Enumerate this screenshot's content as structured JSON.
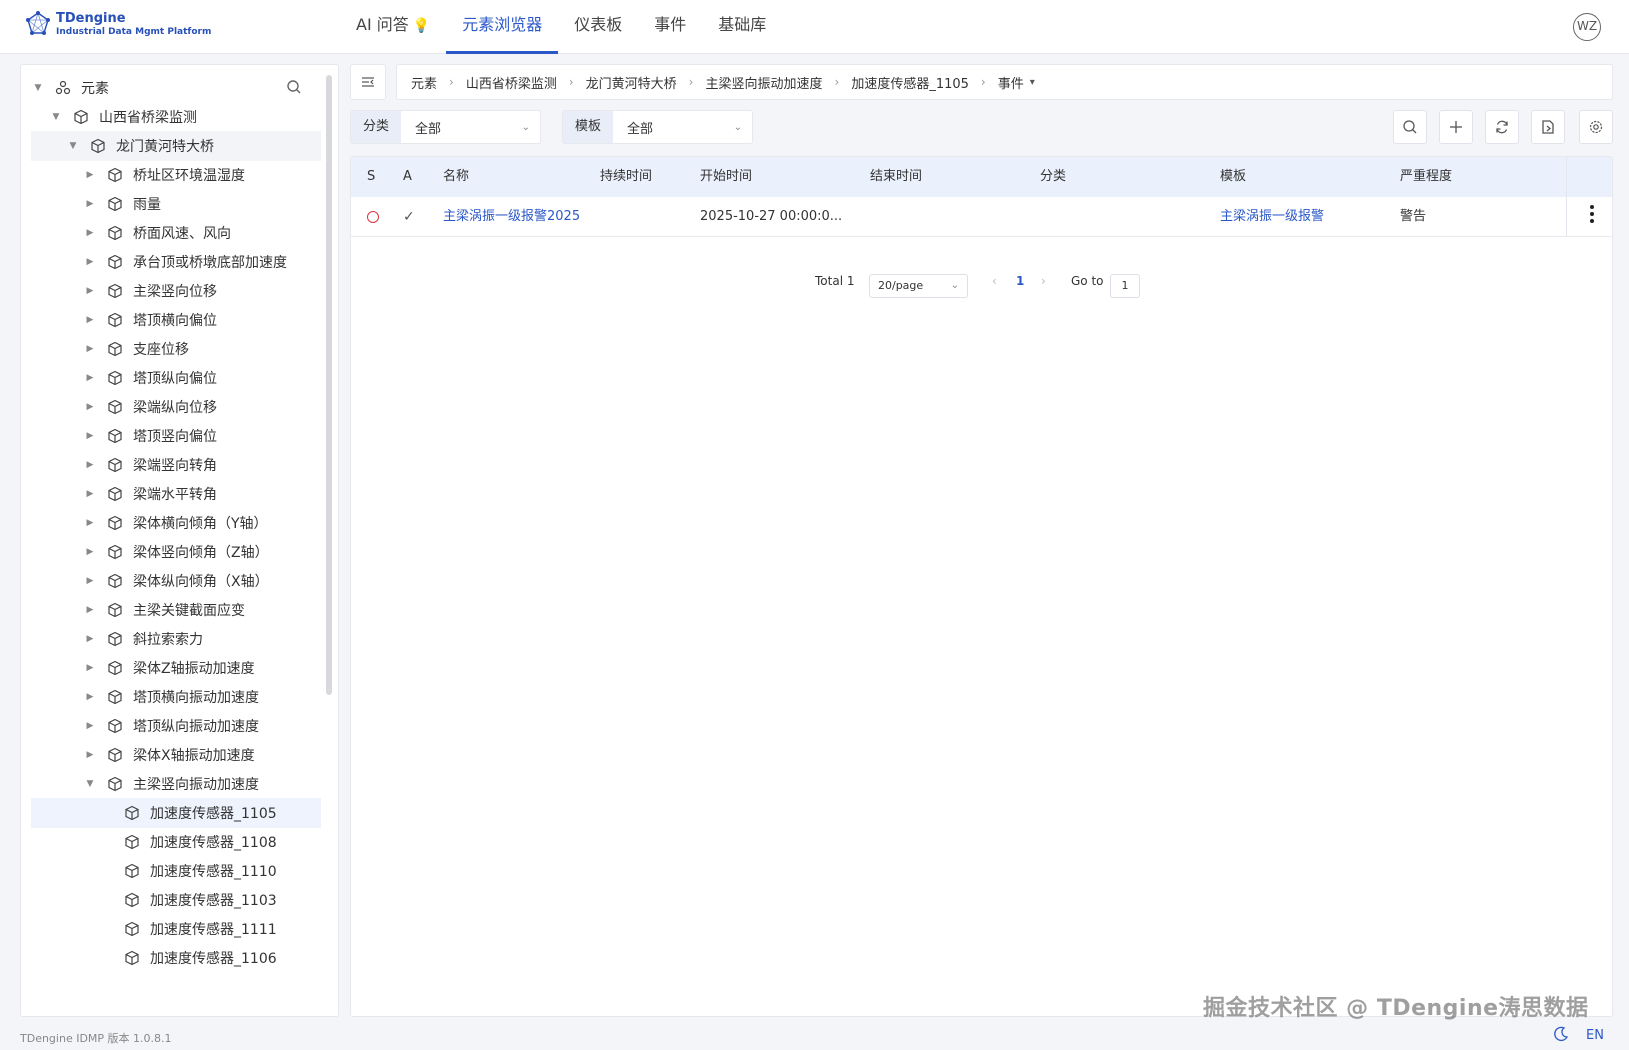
{
  "brand": {
    "name": "TDengine",
    "tagline": "Industrial Data Mgmt Platform"
  },
  "nav": [
    {
      "label": "AI 问答",
      "active": false
    },
    {
      "label": "元素浏览器",
      "active": true
    },
    {
      "label": "仪表板",
      "active": false
    },
    {
      "label": "事件",
      "active": false
    },
    {
      "label": "基础库",
      "active": false
    }
  ],
  "user": {
    "initials": "WZ"
  },
  "tree": {
    "root": "元素",
    "items": [
      {
        "label": "山西省桥梁监测",
        "level": 1,
        "expanded": true
      },
      {
        "label": "龙门黄河特大桥",
        "level": 2,
        "expanded": true
      },
      {
        "label": "桥址区环境温湿度",
        "level": 3
      },
      {
        "label": "雨量",
        "level": 3
      },
      {
        "label": "桥面风速、风向",
        "level": 3
      },
      {
        "label": "承台顶或桥墩底部加速度",
        "level": 3
      },
      {
        "label": "主梁竖向位移",
        "level": 3
      },
      {
        "label": "塔顶横向偏位",
        "level": 3
      },
      {
        "label": "支座位移",
        "level": 3
      },
      {
        "label": "塔顶纵向偏位",
        "level": 3
      },
      {
        "label": "梁端纵向位移",
        "level": 3
      },
      {
        "label": "塔顶竖向偏位",
        "level": 3
      },
      {
        "label": "梁端竖向转角",
        "level": 3
      },
      {
        "label": "梁端水平转角",
        "level": 3
      },
      {
        "label": "梁体横向倾角（Y轴）",
        "level": 3
      },
      {
        "label": "梁体竖向倾角（Z轴）",
        "level": 3
      },
      {
        "label": "梁体纵向倾角（X轴）",
        "level": 3
      },
      {
        "label": "主梁关键截面应变",
        "level": 3
      },
      {
        "label": "斜拉索索力",
        "level": 3
      },
      {
        "label": "梁体Z轴振动加速度",
        "level": 3
      },
      {
        "label": "塔顶横向振动加速度",
        "level": 3
      },
      {
        "label": "塔顶纵向振动加速度",
        "level": 3
      },
      {
        "label": "梁体X轴振动加速度",
        "level": 3
      },
      {
        "label": "主梁竖向振动加速度",
        "level": 3,
        "expanded": true
      },
      {
        "label": "加速度传感器_1105",
        "level": 4,
        "selected": true
      },
      {
        "label": "加速度传感器_1108",
        "level": 4
      },
      {
        "label": "加速度传感器_1110",
        "level": 4
      },
      {
        "label": "加速度传感器_1103",
        "level": 4
      },
      {
        "label": "加速度传感器_1111",
        "level": 4
      },
      {
        "label": "加速度传感器_1106",
        "level": 4
      }
    ]
  },
  "breadcrumb": [
    "元素",
    "山西省桥梁监测",
    "龙门黄河特大桥",
    "主梁竖向振动加速度",
    "加速度传感器_1105",
    "事件"
  ],
  "filters": {
    "category": {
      "label": "分类",
      "value": "全部"
    },
    "template": {
      "label": "模板",
      "value": "全部"
    }
  },
  "table": {
    "columns": [
      "S",
      "A",
      "名称",
      "持续时间",
      "开始时间",
      "结束时间",
      "分类",
      "模板",
      "严重程度"
    ],
    "rows": [
      {
        "name": "主梁涡振一级报警2025",
        "duration": "",
        "start": "2025-10-27 00:00:0...",
        "end": "",
        "category": "",
        "template": "主梁涡振一级报警",
        "severity": "警告"
      }
    ]
  },
  "pagination": {
    "total": "Total 1",
    "page_size": "20/page",
    "current": "1",
    "goto_label": "Go to",
    "goto_value": "1"
  },
  "footer": {
    "version": "TDengine IDMP 版本 1.0.8.1",
    "lang": "EN"
  },
  "watermark": "掘金技术社区 @ TDengine涛思数据",
  "colors": {
    "accent": "#2b58c9",
    "header_bg": "#eaf0fc",
    "status_red": "#d9363e"
  }
}
